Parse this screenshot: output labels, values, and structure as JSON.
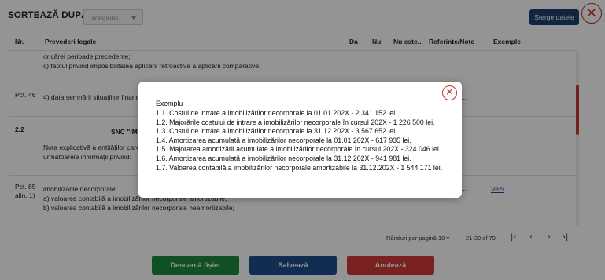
{
  "sort": {
    "label": "SORTEAZĂ DUPĂ:",
    "selected": "Raspuns"
  },
  "actions": {
    "delete_label": "Șterge datele",
    "close_glyph": "×"
  },
  "table": {
    "headers": [
      "Nr.",
      "Prevederi legale",
      "Da",
      "Nu",
      "Nu este...",
      "Referinte/Note",
      "Exemple"
    ]
  },
  "rows": {
    "r0_line1": "oricărei perioade precedente;",
    "r0_line2": "c) faptul privind imposibilitatea aplicării retroactive a aplicării comparative;",
    "r1_nr": "Pct. 46",
    "r1_text": "4) data semnării situaţiilor financiare",
    "r1_dots": "...",
    "r2_nr": "2.2",
    "r2_heading": "SNC \"IMOBILIZĂRI NECORPORALE\"",
    "r2_line1": "Nota explicativă a entităţilor care aplică SNC \"Imobilizări necorporale\" trebuie să prezinte",
    "r2_line2": "următoarele informaţii privind:",
    "r3_nr1": "Pct. 85",
    "r3_nr2": "alin. 1)",
    "r3_line1": "imobilizările necorporale:",
    "r3_line2": "a) valoarea contabilă a imobilizărilor necorporale amortizabile;",
    "r3_line3": "b) valoarea contabilă a imobilizărilor necorporale neamortizabile;",
    "r3_dots": "...",
    "r3_link": "Vezi"
  },
  "pagination": {
    "rows_label": "Rânduri per pagină",
    "rows_value": "10",
    "range": "21-30 of 79"
  },
  "buttons": {
    "download": "Descarcă fișier",
    "save": "Salvează",
    "cancel": "Anulează"
  },
  "modal": {
    "title": "Exemplu",
    "items": [
      "1.1. Costul de intrare a imobilizărilor necorporale la 01.01.202X - 2 341 152 lei.",
      "1.2. Majorările costului de intrare a imobilizărilor necorporale în cursul 202X - 1 226 500 lei.",
      "1.3. Costul de intrare a imobilizărilor necorporale la 31.12.202X - 3 567 652 lei.",
      "1.4. Amortizarea acumulată a imobilizărilor necorporale la 01.01.202X - 617 935 lei.",
      "1.5. Majorarea amortizării acumulate a imobilizărilor necorporale în cursul 202X - 324 046 lei.",
      "1.6. Amortizarea acumulată a imobilizărilor necorporale la 31.12.202X - 941 981 lei.",
      "1.7. Valoarea contabilă a imobilizărilor necorporale amortizabile la 31.12.202X - 1 544 171 lei."
    ]
  },
  "colors": {
    "primary": "#1e3f6e",
    "success": "#1d8a3b",
    "danger": "#d23a3a",
    "close_red": "#c0302a",
    "link": "#1a4aa8"
  }
}
